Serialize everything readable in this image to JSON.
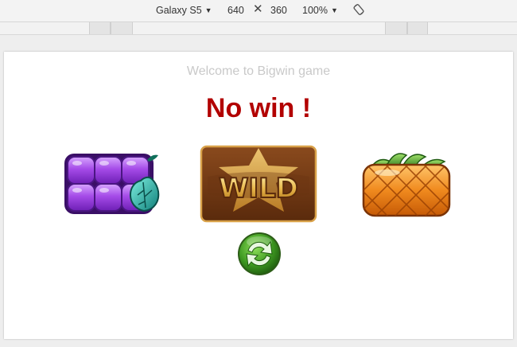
{
  "devtools": {
    "device_name": "Galaxy S5",
    "width_value": "640",
    "times_symbol": "✕",
    "height_value": "360",
    "zoom_value": "100%",
    "caret": "▼"
  },
  "game": {
    "welcome_text": "Welcome to Bigwin game",
    "result_text": "No win !",
    "reels": [
      {
        "symbol": "grape-icon"
      },
      {
        "symbol": "wild-icon",
        "label": "WILD"
      },
      {
        "symbol": "pineapple-icon"
      }
    ],
    "spin_icon": "refresh-icon"
  },
  "colors": {
    "result": "#b20000",
    "welcome": "#c9c9c9",
    "grape": "#9b3fe0",
    "wild_gold": "#e8b64a",
    "wild_frame": "#7a4317",
    "pineapple": "#f08a1e",
    "spin_green": "#3f9a22"
  }
}
